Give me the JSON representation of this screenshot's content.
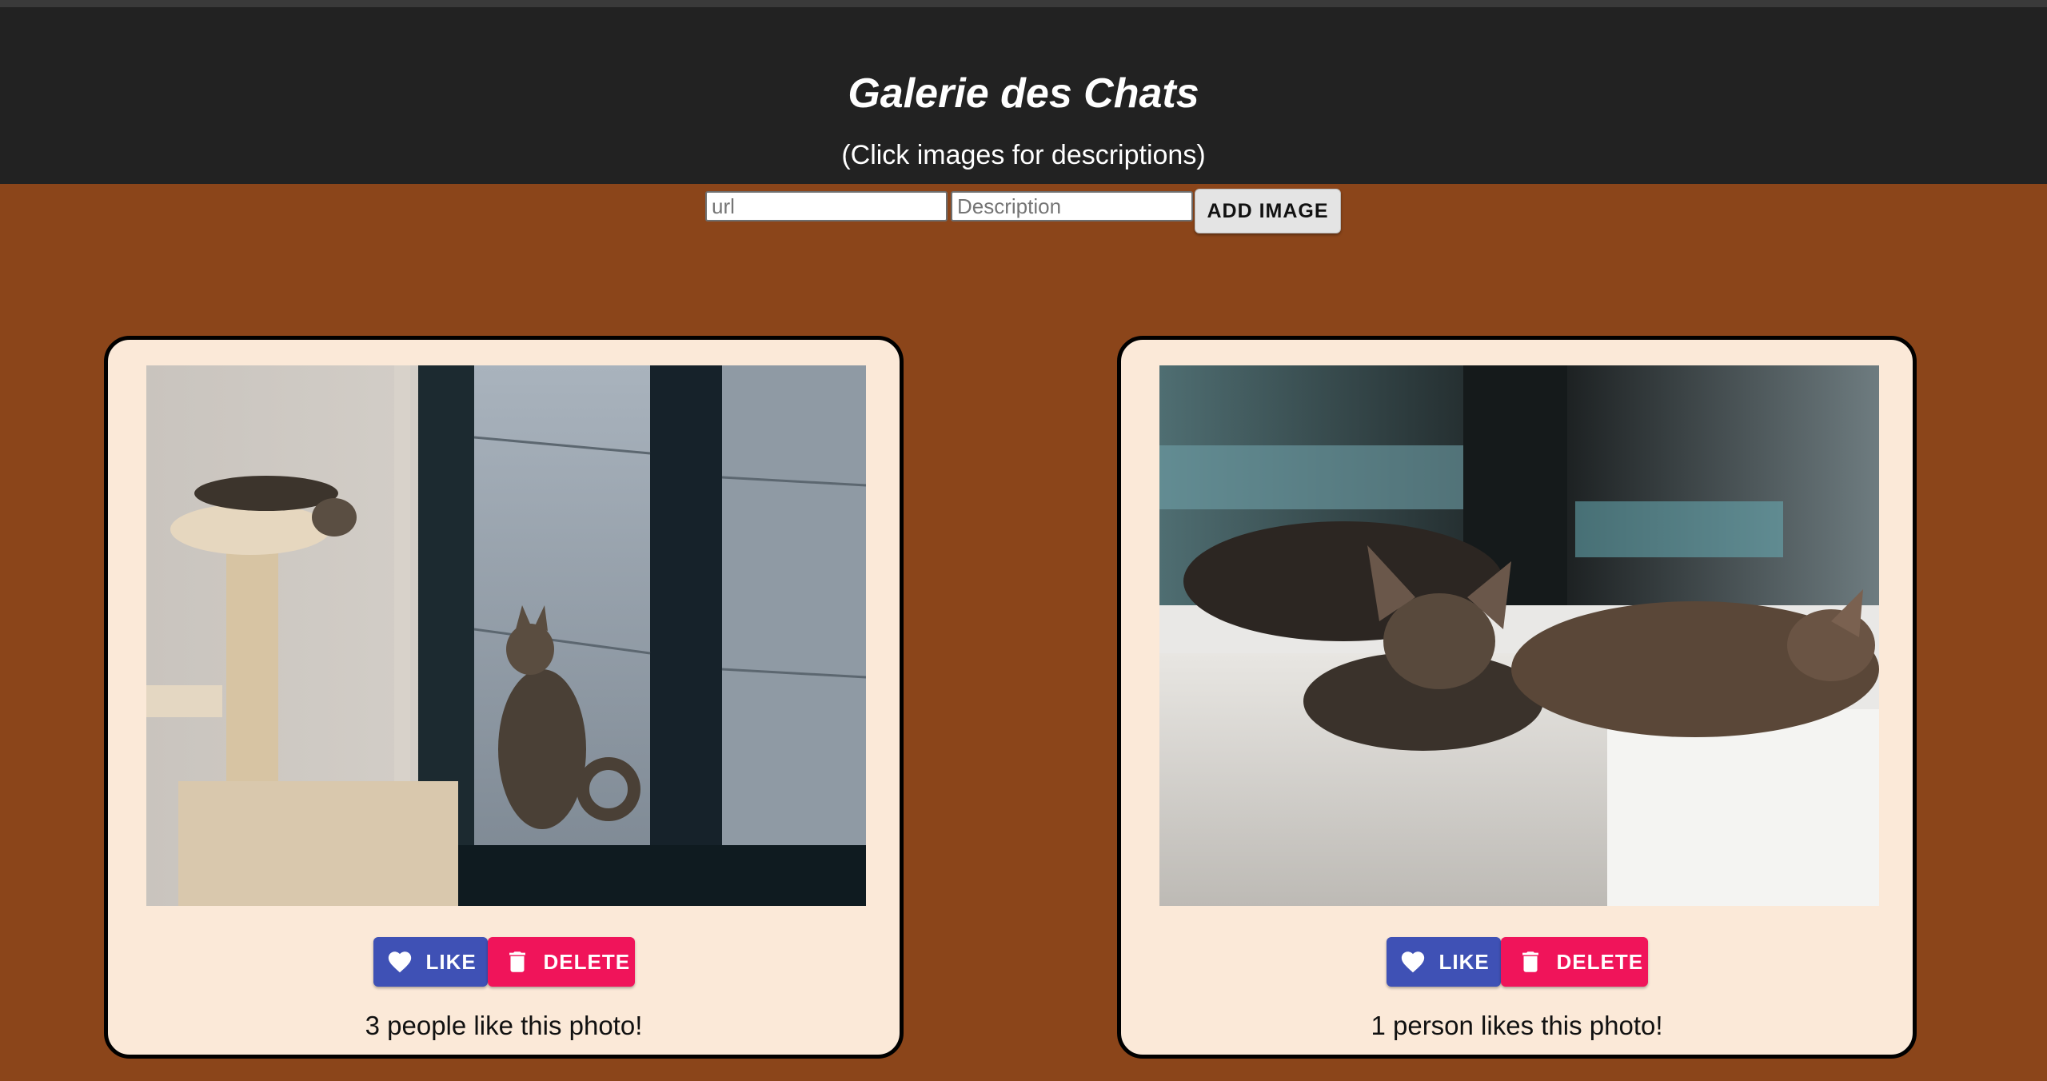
{
  "header": {
    "title": "Galerie des Chats",
    "subtitle": "(Click images for descriptions)"
  },
  "form": {
    "url_placeholder": "url",
    "description_placeholder": "Description",
    "add_button_label": "ADD IMAGE"
  },
  "cards": [
    {
      "like_label": "LIKE",
      "delete_label": "DELETE",
      "likes_text": "3 people like this photo!"
    },
    {
      "like_label": "LIKE",
      "delete_label": "DELETE",
      "likes_text": "1 person likes this photo!"
    }
  ],
  "colors": {
    "background": "#8b451a",
    "header": "#222222",
    "card": "#fbe9d8",
    "like": "#3f51b5",
    "delete": "#f0145a"
  },
  "icons": {
    "like": "heart-icon",
    "delete": "trash-icon"
  }
}
